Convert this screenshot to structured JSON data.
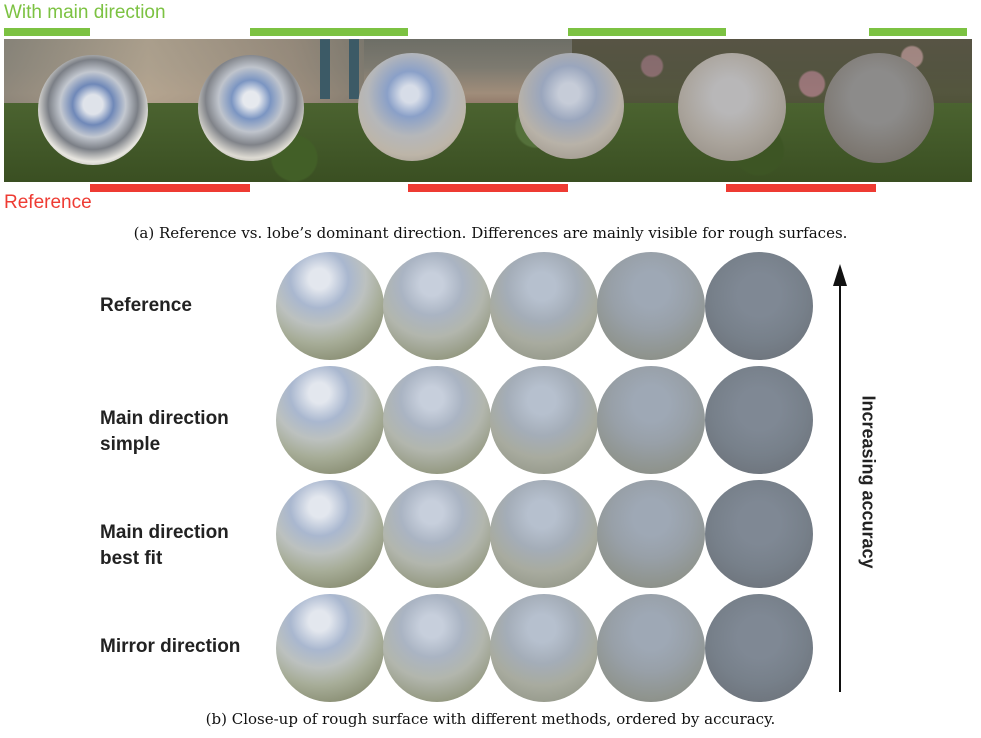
{
  "panel_a": {
    "legend_top": "With main direction",
    "legend_bottom": "Reference",
    "colors": {
      "main_direction": "#7cc242",
      "reference": "#ee3b33"
    },
    "caption": "(a) Reference vs. lobe’s dominant direction. Differences are mainly visible for rough surfaces."
  },
  "panel_b": {
    "rows": [
      {
        "label_lines": [
          "Reference"
        ]
      },
      {
        "label_lines": [
          "Main direction",
          "simple"
        ]
      },
      {
        "label_lines": [
          "Main direction",
          "best fit"
        ]
      },
      {
        "label_lines": [
          "Mirror direction"
        ]
      }
    ],
    "axis_label": "Increasing accuracy",
    "caption": "(b) Close-up of rough surface with different methods, ordered by accuracy."
  }
}
